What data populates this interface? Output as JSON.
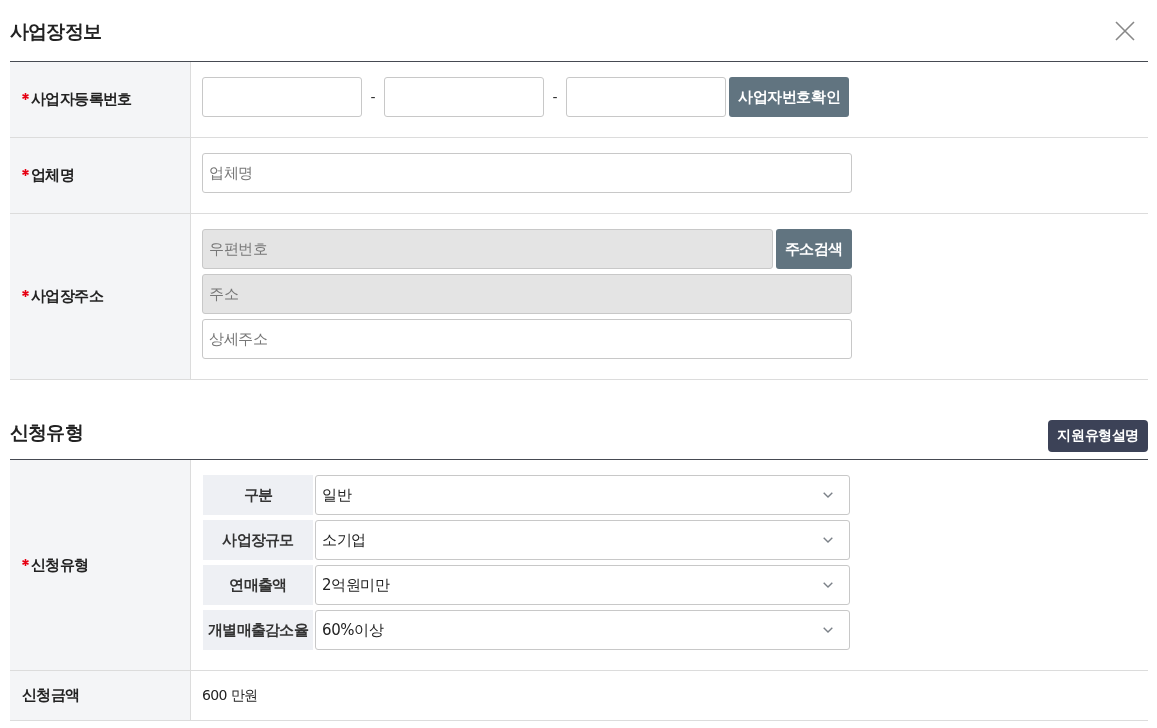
{
  "sections": [
    {
      "title": "사업장정보",
      "action": {
        "kind": "close"
      },
      "rows": [
        {
          "kind": "inline",
          "label": "사업자등록번호",
          "required": true,
          "fields": [
            {
              "disabled": false
            },
            {
              "disabled": false
            },
            {
              "disabled": false
            }
          ],
          "separators": [
            "-",
            "-"
          ],
          "button": "사업자번호확인"
        },
        {
          "kind": "stacked",
          "label": "업체명",
          "required": true,
          "fields": [
            {
              "placeholder": "업체명",
              "disabled": false
            }
          ]
        },
        {
          "kind": "stacked",
          "label": "사업장주소",
          "required": true,
          "fields": [
            {
              "placeholder": "우편번호",
              "disabled": true,
              "button": "주소검색"
            },
            {
              "placeholder": "주소",
              "disabled": true
            },
            {
              "placeholder": "상세주소",
              "disabled": false
            }
          ]
        }
      ]
    },
    {
      "title": "신청유형",
      "action": {
        "kind": "button",
        "label": "지원유형설명"
      },
      "rows": [
        {
          "kind": "selects",
          "label": "신청유형",
          "required": true,
          "selects": [
            {
              "label": "구분",
              "value": "일반"
            },
            {
              "label": "사업장규모",
              "value": "소기업"
            },
            {
              "label": "연매출액",
              "value": "2억원미만"
            },
            {
              "label": "개별매출감소율",
              "value": "60%이상"
            }
          ]
        },
        {
          "kind": "value",
          "label": "신청금액",
          "required": false,
          "value": "600 만원"
        }
      ]
    }
  ]
}
